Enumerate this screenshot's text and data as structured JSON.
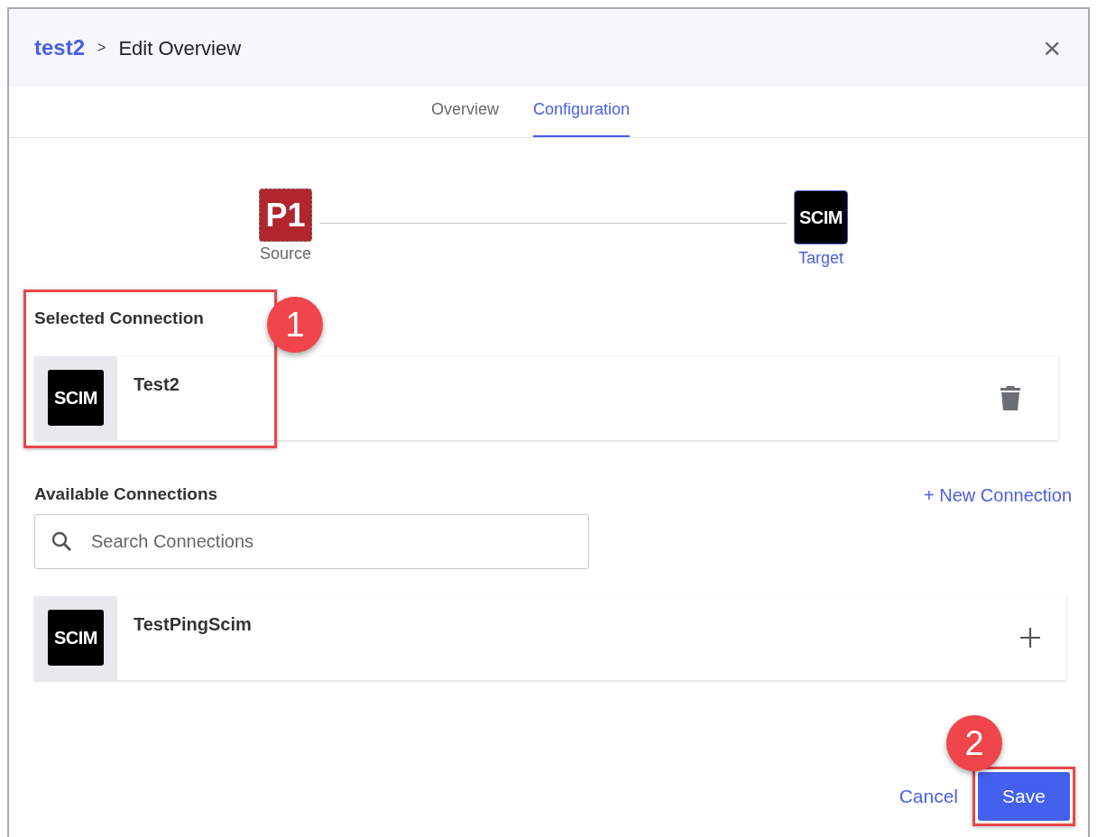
{
  "header": {
    "breadcrumb_link": "test2",
    "separator": ">",
    "title": "Edit Overview",
    "close": "×"
  },
  "tabs": [
    {
      "label": "Overview",
      "selected": false
    },
    {
      "label": "Configuration",
      "selected": true
    }
  ],
  "flow": {
    "source": {
      "logo": "P1",
      "label": "Source"
    },
    "target": {
      "logo": "SCIM",
      "label": "Target"
    }
  },
  "selected_connection": {
    "heading": "Selected Connection",
    "items": [
      {
        "logo": "SCIM",
        "name": "Test2"
      }
    ]
  },
  "available_connections": {
    "heading": "Available Connections",
    "new_link": "+ New Connection",
    "search": {
      "placeholder": "Search Connections"
    },
    "items": [
      {
        "logo": "SCIM",
        "name": "TestPingScim"
      }
    ]
  },
  "footer": {
    "cancel": "Cancel",
    "save": "Save"
  },
  "annotations": [
    "1",
    "2"
  ]
}
